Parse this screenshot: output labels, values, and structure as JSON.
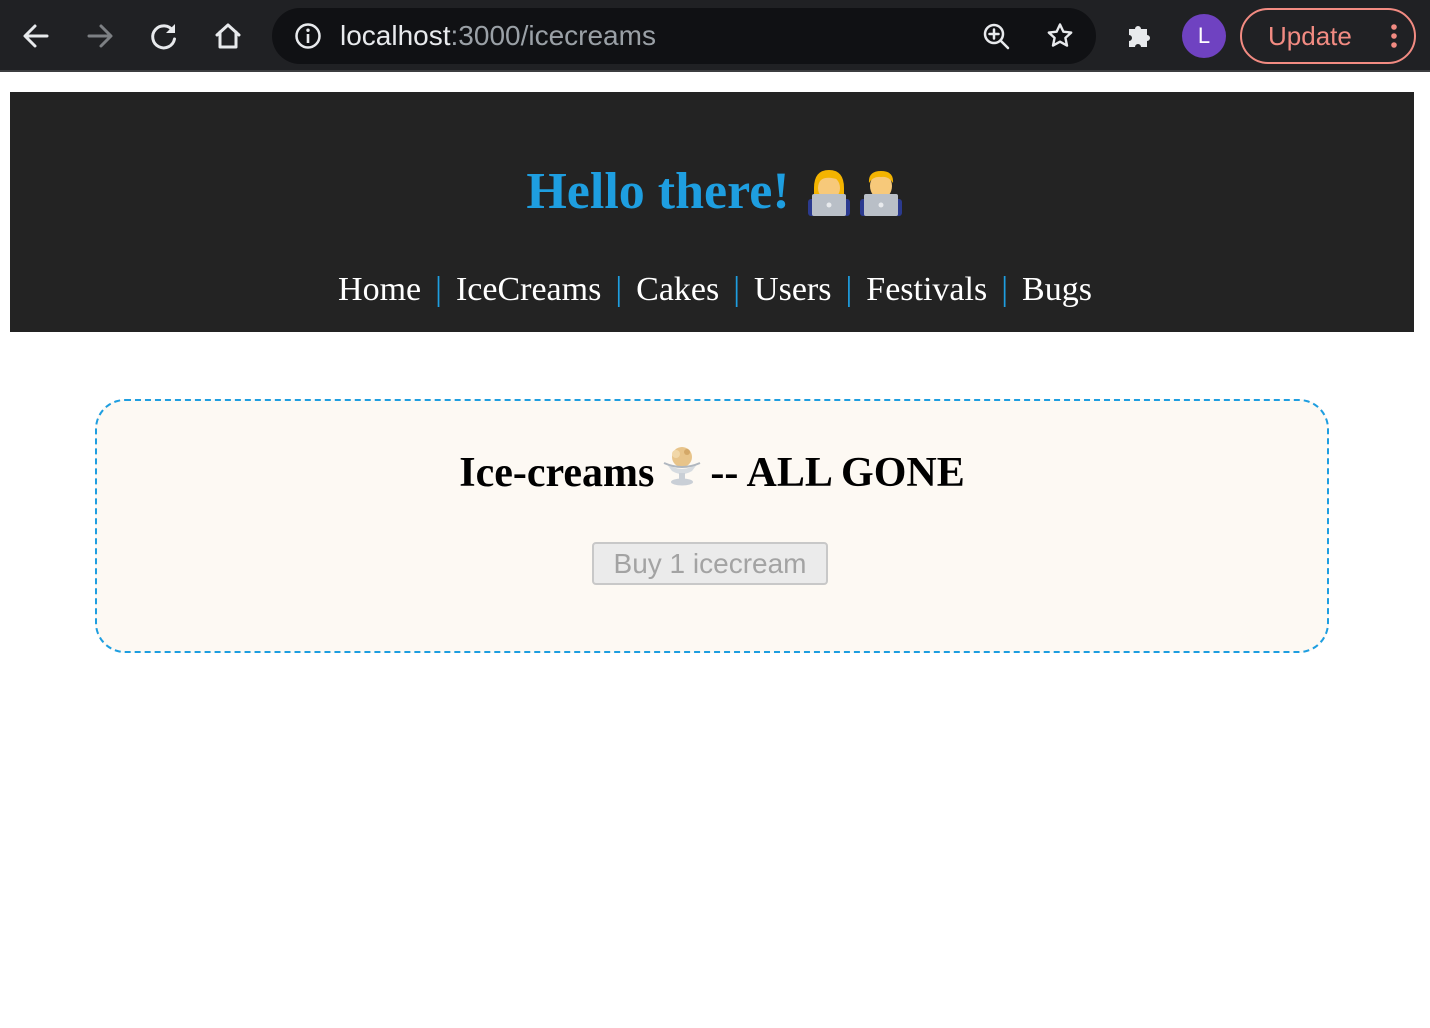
{
  "browser": {
    "url_host": "localhost",
    "url_path": ":3000/icecreams",
    "profile_initial": "L",
    "update_label": "Update"
  },
  "header": {
    "greeting": "Hello there!",
    "nav": [
      "Home",
      "IceCreams",
      "Cakes",
      "Users",
      "Festivals",
      "Bugs"
    ]
  },
  "card": {
    "title_before": "Ice-creams",
    "title_after": "-- ALL GONE",
    "buy_button_label": "Buy 1 icecream",
    "buy_button_disabled": true
  },
  "colors": {
    "accent": "#1e9ee0",
    "header_bg": "#232323",
    "card_bg": "#fdf9f3",
    "update": "#f28b82",
    "avatar": "#6f42c1"
  },
  "icons": [
    "back-arrow-icon",
    "forward-arrow-icon",
    "reload-icon",
    "home-icon",
    "info-icon",
    "zoom-icon",
    "star-icon",
    "extensions-puzzle-icon",
    "kebab-menu-icon",
    "woman-technologist-emoji",
    "man-technologist-emoji",
    "ice-cream-sundae-emoji"
  ]
}
